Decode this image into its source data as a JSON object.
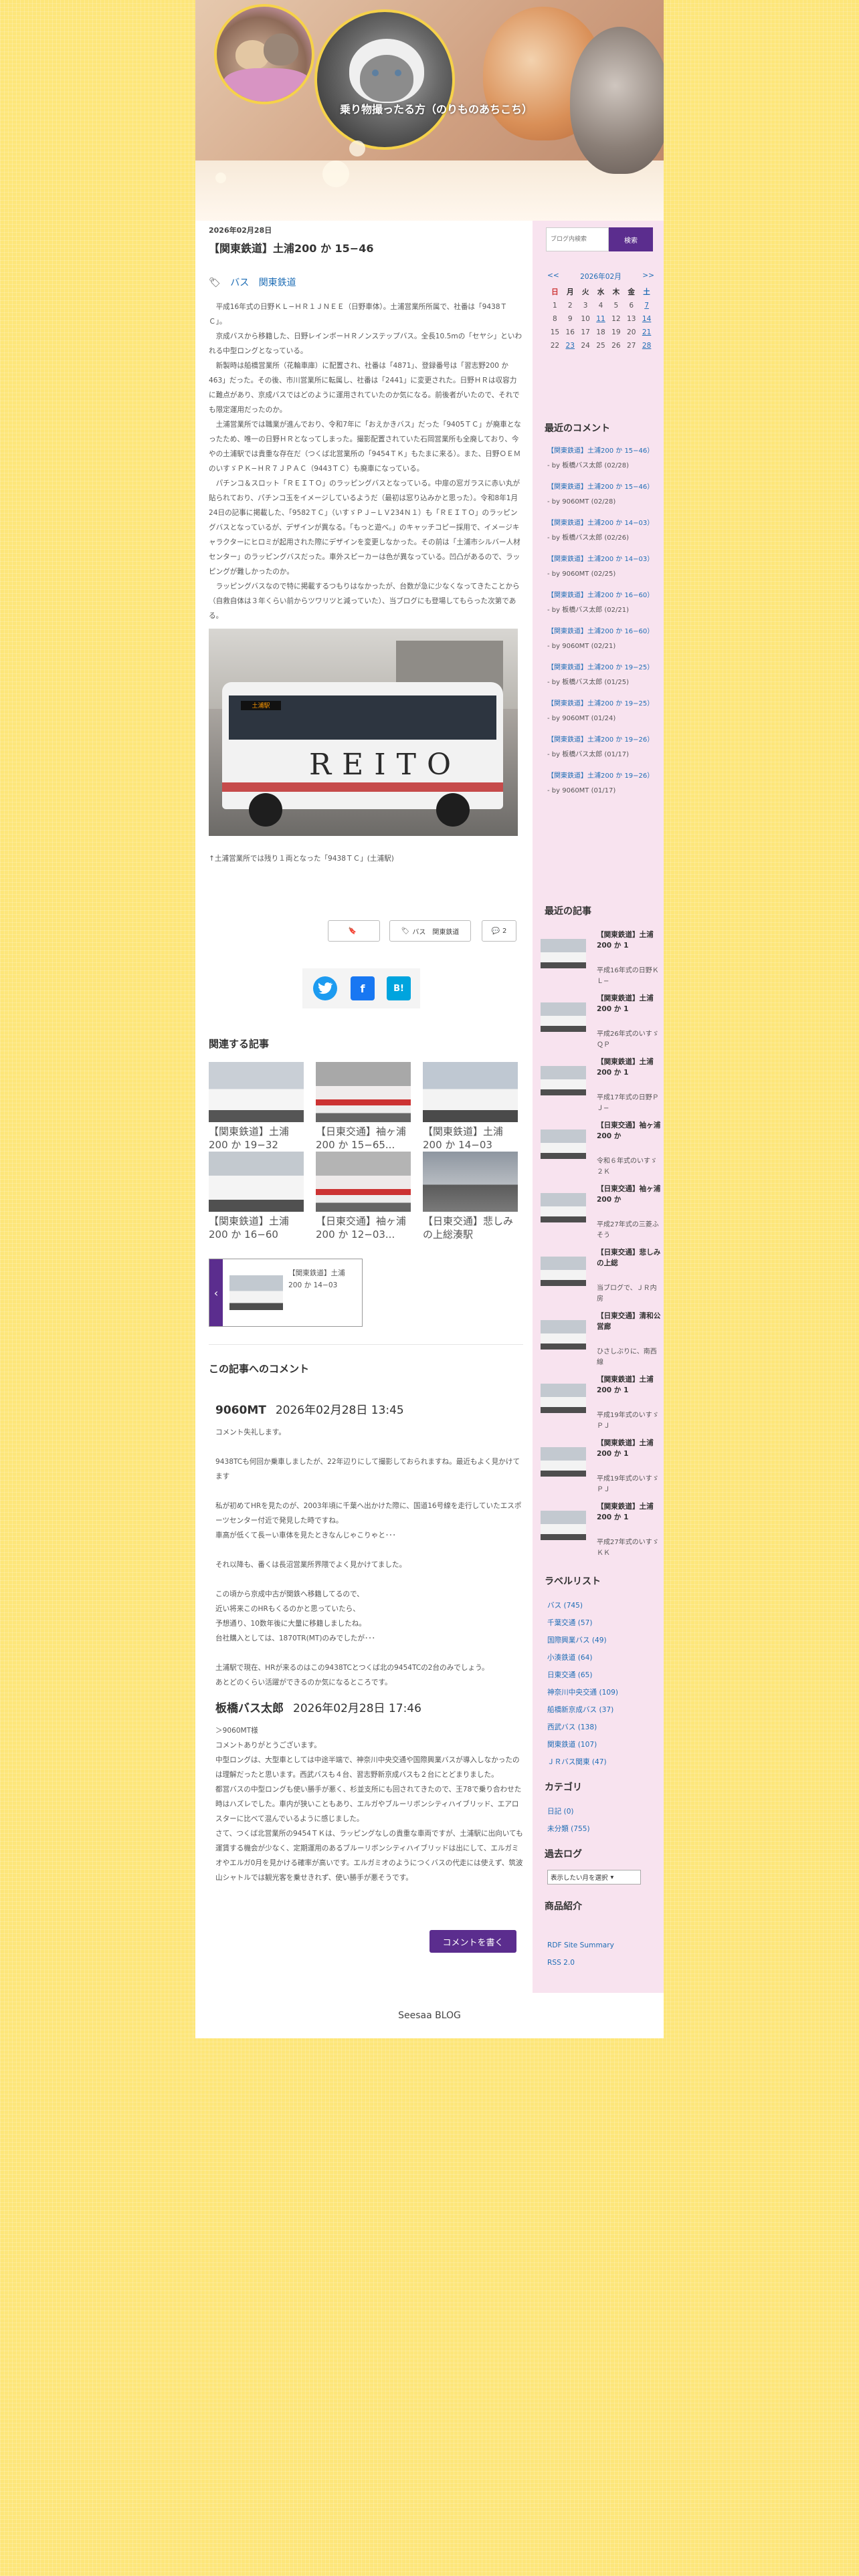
{
  "header": {
    "blog_title": "乗り物撮ったる方（のりものあちこち）"
  },
  "post": {
    "date": "2026年02月28日",
    "title": "【関東鉄道】土浦200 か 15−46",
    "categories": [
      "バス",
      "関東鉄道"
    ],
    "paragraphs": [
      "平成16年式の日野ＫＬ−ＨＲ１ＪＮＥＥ（日野車体）。土浦営業所所属で、社番は「9438ＴＣ」。",
      "京成バスから移籍した、日野レインボーＨＲノンステップバス。全長10.5mの「セヤシ」といわれる中型ロングとなっている。",
      "新製時は船橋営業所（花輪車庫）に配置され、社番は「4871」、登録番号は「習志野200 か 463」だった。その後、市川営業所に転属し、社番は「2441」に変更された。日野ＨＲは収容力に難点があり、京成バスではどのように運用されていたのか気になる。前後者がいたので、それでも限定運用だったのか。",
      "土浦営業所では職業が進んでおり、令和7年に「おえかきバス」だった「9405ＴＣ」が廃車となったため、唯一の日野ＨＲとなってしまった。撮影配置されていた石岡営業所も全廃しており、今やの土浦駅では貴重な存在だ（つくば北営業所の「9454ＴＫ」もたまに来る）。また、日野ＯＥＭのいすゞＰＫ−ＨＲ７ＪＰＡＣ（9443ＴＣ）も廃車になっている。",
      "パチンコ＆スロット「ＲＥＩＴＯ」のラッピングバスとなっている。中扉の窓ガラスに赤い丸が貼られており、パチンコ玉をイメージしているようだ（最初は窓り込みかと思った）。令和8年1月24日の記事に掲載した、「9582ＴＣ」（いすゞＰＪ−ＬＶ234Ｎ１）も「ＲＥＩＴＯ」のラッピングバスとなっているが、デザインが異なる。「もっと遊べ。」のキャッチコピー採用で、イメージキャラクターにヒロミが起用された際にデザインを変更しなかった。その前は「土浦市シルバー人材センター」のラッピングバスだった。車外スピーカーは色が異なっている。凹凸があるので、ラッピングが難しかったのか。",
      "ラッピングバスなので特に掲載するつもりはなかったが、台数が急に少なくなってきたことから（自救自体は３年くらい前からツワリツと減っていた）、当ブログにも登場してもらった次第である。"
    ],
    "photo_caption": "↑土浦営業所では残り１両となった「9438ＴＣ」(土浦駅)",
    "meta": {
      "author": "",
      "category": "バス　関東鉄道",
      "comments": "2"
    }
  },
  "photo": {
    "bus_brand": "REITO",
    "sign": "土浦駅"
  },
  "related": {
    "heading": "関連する記事",
    "items": [
      "【関東鉄道】土浦200 か 19−32",
      "【日東交通】袖ヶ浦200 か 15−65...",
      "【関東鉄道】土浦200 か 14−03",
      "【関東鉄道】土浦200 か 16−60",
      "【日東交通】袖ヶ浦200 か 12−03...",
      "【日東交通】悲しみの上総湊駅"
    ],
    "prev_title": "【関東鉄道】土浦200 か 14−03"
  },
  "comments": {
    "heading": "この記事へのコメント",
    "items": [
      {
        "author": "9060MT",
        "date": "2026年02月28日 13:45",
        "text": "コメント失礼します。\n\n9438TCも何回か乗車しましたが、22年辺りにして撮影しておられますね。最近もよく見かけてます\n\n私が初めてHRを見たのが、2003年頃に千葉へ出かけた際に、国道16号線を走行していたエスポーツセンター付近で発見した時ですね。\n車高が低くて長ーい車体を見たときなんじゃこりゃと･･･\n\nそれ以降も、番くは長沼営業所界隈でよく見かけてました。\n\nこの頃から京成中古が関鉄へ移籍してるので、\n近い将来このHRもくるのかと思っていたら、\n予想通り、10数年後に大量に移籍しましたね。\n台社購入としては、1870TR(MT)のみでしたが･･･\n\n土浦駅で現在、HRが来るのはこの9438TCとつくば北の9454TCの2台のみでしょう。\nあとどのくらい活躍ができるのか気になるところです。"
      },
      {
        "author": "板橋バス太郎",
        "date": "2026年02月28日 17:46",
        "text": "＞9060MT様\nコメントありがとうございます。\n中型ロングは、大型車としては中途半端で、神奈川中央交通や国際興業バスが導入しなかったのは理解だったと思います。西武バスも４台、習志野新京成バスも２台にとどまりました。\n都営バスの中型ロングも使い勝手が悪く、杉並支所にも回されてきたので、王78で乗り合わせた時はハズレでした。車内が狭いこともあり、エルガやブルーリボンシティハイブリッド、エアロスターに比べて混んでいるように感じました。\nさて、つくば北営業所の9454ＴＫは、ラッピングなしの貴重な車両ですが、土浦駅に出向いても運賃する機会が少なく、定期運用のあるブルーリボンシティハイブリッドは出にして、エルガミオやエルガ0月を見かける確率が高いです。エルガミオのようにつくバスの代走には使えず、筑波山シャトルでは観光客を乗せきれず、使い勝手が悪そうです。"
      }
    ],
    "write_button": "コメントを書く"
  },
  "sidebar": {
    "search_placeholder": "ブログ内検索",
    "search_button": "検索",
    "calendar": {
      "prev": "<<",
      "title": "2026年02月",
      "next": ">>",
      "weekdays": [
        "日",
        "月",
        "火",
        "水",
        "木",
        "金",
        "土"
      ],
      "weeks": [
        [
          "1",
          "2",
          "3",
          "4",
          "5",
          "6",
          "7"
        ],
        [
          "8",
          "9",
          "10",
          "11",
          "12",
          "13",
          "14"
        ],
        [
          "15",
          "16",
          "17",
          "18",
          "19",
          "20",
          "21"
        ],
        [
          "22",
          "23",
          "24",
          "25",
          "26",
          "27",
          "28"
        ]
      ],
      "linked_days": [
        "7",
        "11",
        "14",
        "21",
        "23",
        "28"
      ]
    },
    "recent_comments_heading": "最近のコメント",
    "recent_comments": [
      {
        "title": "【関東鉄道】土浦200 か 15−46）",
        "by": "- by 板橋バス太郎 (02/28)"
      },
      {
        "title": "【関東鉄道】土浦200 か 15−46）",
        "by": "- by 9060MT (02/28)"
      },
      {
        "title": "【関東鉄道】土浦200 か 14−03）",
        "by": "- by 板橋バス太郎 (02/26)"
      },
      {
        "title": "【関東鉄道】土浦200 か 14−03）",
        "by": "- by 9060MT (02/25)"
      },
      {
        "title": "【関東鉄道】土浦200 か 16−60）",
        "by": "- by 板橋バス太郎 (02/21)"
      },
      {
        "title": "【関東鉄道】土浦200 か 16−60）",
        "by": "- by 9060MT (02/21)"
      },
      {
        "title": "【関東鉄道】土浦200 か 19−25）",
        "by": "- by 板橋バス太郎 (01/25)"
      },
      {
        "title": "【関東鉄道】土浦200 か 19−25）",
        "by": "- by 9060MT (01/24)"
      },
      {
        "title": "【関東鉄道】土浦200 か 19−26）",
        "by": "- by 板橋バス太郎 (01/17)"
      },
      {
        "title": "【関東鉄道】土浦200 か 19−26）",
        "by": "- by 9060MT (01/17)"
      }
    ],
    "recent_articles_heading": "最近の記事",
    "recent_articles": [
      {
        "title": "【関東鉄道】土浦200 か 1",
        "excerpt": "平成16年式の日野ＫＬ−"
      },
      {
        "title": "【関東鉄道】土浦200 か 1",
        "excerpt": "平成26年式のいすゞＱＰ"
      },
      {
        "title": "【関東鉄道】土浦200 か 1",
        "excerpt": "平成17年式の日野ＰＪ−"
      },
      {
        "title": "【日東交通】袖ヶ浦200 か",
        "excerpt": "令和６年式のいすゞ２Ｋ"
      },
      {
        "title": "【日東交通】袖ヶ浦200 か",
        "excerpt": "平成27年式の三菱ふそう"
      },
      {
        "title": "【日東交通】悲しみの上総",
        "excerpt": "当ブログで、ＪＲ内房"
      },
      {
        "title": "【日東交通】清和公営廊",
        "excerpt": "ひさしぶりに、南西線"
      },
      {
        "title": "【関東鉄道】土浦200 か 1",
        "excerpt": "平成19年式のいすゞＰＪ"
      },
      {
        "title": "【関東鉄道】土浦200 か 1",
        "excerpt": "平成19年式のいすゞＰＪ"
      },
      {
        "title": "【関東鉄道】土浦200 か 1",
        "excerpt": "平成27年式のいすゞＫＫ"
      }
    ],
    "labels_heading": "ラベルリスト",
    "labels": [
      "バス (745)",
      "千葉交通 (57)",
      "国際興業バス (49)",
      "小湊鉄道 (64)",
      "日東交通 (65)",
      "神奈川中央交通 (109)",
      "船橋新京成バス (37)",
      "西武バス (138)",
      "関東鉄道 (107)",
      "ＪＲバス関東 (47)"
    ],
    "category_heading": "カテゴリ",
    "categories": [
      "日記 (0)",
      "未分類 (755)"
    ],
    "archive_heading": "過去ログ",
    "archive_select": "表示したい月を選択",
    "profile_heading": "商品紹介",
    "feeds": [
      "RDF Site Summary",
      "RSS 2.0"
    ]
  },
  "footer": {
    "text": "Seesaa BLOG"
  },
  "colors": {
    "accent": "#5b2d8e",
    "link": "#1e6db5",
    "sidebar_bg": "#f8e3ef",
    "page_bg": "#fde67a"
  }
}
